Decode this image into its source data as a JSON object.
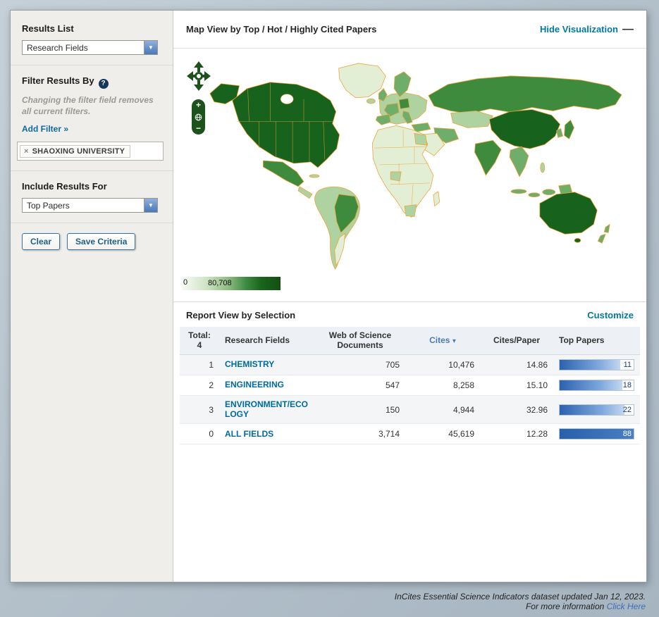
{
  "sidebar": {
    "results_list_label": "Results List",
    "results_list_value": "Research Fields",
    "filter_by_label": "Filter Results By",
    "filter_note": "Changing the filter field removes all current filters.",
    "add_filter_label": "Add Filter »",
    "filter_tag_label": "SHAOXING UNIVERSITY",
    "include_label": "Include Results For",
    "include_value": "Top Papers",
    "clear_button": "Clear",
    "save_button": "Save Criteria"
  },
  "map_panel": {
    "title": "Map View by Top / Hot / Highly Cited Papers",
    "hide_link": "Hide Visualization",
    "legend": {
      "min": "0",
      "max": "80,708"
    }
  },
  "report_panel": {
    "title": "Report View by Selection",
    "customize_link": "Customize",
    "header": {
      "total_label": "Total:",
      "total_value": "4",
      "col_field": "Research Fields",
      "col_docs": "Web of Science Documents",
      "col_cites": "Cites",
      "col_cpp": "Cites/Paper",
      "col_top": "Top Papers"
    }
  },
  "chart_data": {
    "type": "table",
    "sorted_by": "Cites descending",
    "columns": [
      "Rank",
      "Research Fields",
      "Web of Science Documents",
      "Cites",
      "Cites/Paper",
      "Top Papers"
    ],
    "rows": [
      {
        "rank": "1",
        "field": "CHEMISTRY",
        "docs": "705",
        "cites": "10,476",
        "cites_per_paper": "14.86",
        "top_papers": 11,
        "bar_pct": 82
      },
      {
        "rank": "2",
        "field": "ENGINEERING",
        "docs": "547",
        "cites": "8,258",
        "cites_per_paper": "15.10",
        "top_papers": 18,
        "bar_pct": 85
      },
      {
        "rank": "3",
        "field": "ENVIRONMENT/ECOLOGY",
        "docs": "150",
        "cites": "4,944",
        "cites_per_paper": "32.96",
        "top_papers": 22,
        "bar_pct": 88
      },
      {
        "rank": "0",
        "field": "ALL FIELDS",
        "docs": "3,714",
        "cites": "45,619",
        "cites_per_paper": "12.28",
        "top_papers": 88,
        "bar_pct": 100
      }
    ],
    "map_legend_range": [
      0,
      80708
    ]
  },
  "icons": {
    "dropdown_arrow": "▼",
    "help": "?",
    "close": "×",
    "collapse": "—",
    "zoom_in": "+",
    "zoom_out": "−",
    "sort_desc": "▾"
  },
  "footer": {
    "line1": "InCites Essential Science Indicators dataset updated Jan 12, 2023.",
    "line2_prefix": "For more information ",
    "link": "Click Here"
  },
  "colors": {
    "teal_link": "#0079a1",
    "field_link": "#006a9e",
    "bar_blue": "#2a62ae",
    "map_border": "#eda53a",
    "map_greens": [
      "#17621c",
      "#3e8b3e",
      "#6fae6a",
      "#aed3a0",
      "#e2efd5"
    ]
  }
}
